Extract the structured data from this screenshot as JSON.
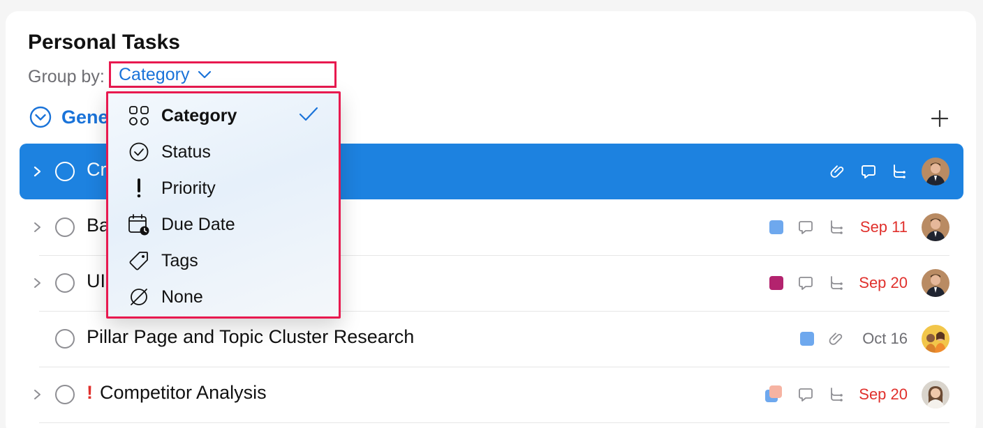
{
  "page": {
    "title": "Personal Tasks"
  },
  "group_by": {
    "label": "Group by:",
    "selected": "Category",
    "options": [
      {
        "label": "Category",
        "icon": "category-grid-icon",
        "selected": true
      },
      {
        "label": "Status",
        "icon": "status-check-circle-icon",
        "selected": false
      },
      {
        "label": "Priority",
        "icon": "priority-exclamation-icon",
        "selected": false
      },
      {
        "label": "Due Date",
        "icon": "due-date-calendar-icon",
        "selected": false
      },
      {
        "label": "Tags",
        "icon": "tag-icon",
        "selected": false
      },
      {
        "label": "None",
        "icon": "none-slash-circle-icon",
        "selected": false
      }
    ]
  },
  "group": {
    "title": "Gene",
    "icon": "collapse-chevron-circle-icon"
  },
  "tasks": [
    {
      "title": "Cr",
      "selected": true,
      "priority": false,
      "due": "",
      "icons": [
        "attachment-icon",
        "comment-icon",
        "subtask-icon"
      ],
      "avatar": "avatar-man-suit"
    },
    {
      "title": "Ba",
      "selected": false,
      "priority": false,
      "color": "#6ea8ee",
      "due": "Sep 11",
      "icons": [
        "comment-icon",
        "subtask-icon"
      ],
      "avatar": "avatar-man-suit"
    },
    {
      "title": "UI",
      "selected": false,
      "priority": false,
      "color": "#b3236e",
      "due": "Sep 20",
      "icons": [
        "comment-icon",
        "subtask-icon"
      ],
      "avatar": "avatar-man-suit"
    },
    {
      "title": "Pillar Page and Topic Cluster Research",
      "selected": false,
      "priority": false,
      "color": "#6ea8ee",
      "due": "Oct 16",
      "icons": [
        "attachment-icon"
      ],
      "avatar": "avatar-women-group"
    },
    {
      "title": "Competitor Analysis",
      "selected": false,
      "priority": true,
      "priority_mark": "!",
      "colors": [
        "#6ea8ee",
        "#f6b3a2"
      ],
      "due": "Sep 20",
      "icons": [
        "comment-icon",
        "subtask-icon"
      ],
      "avatar": "avatar-woman"
    }
  ],
  "colors": {
    "accent": "#1a73d9",
    "selection": "#1d82e0",
    "overdue": "#e0302c",
    "highlight_border": "#e8194f"
  }
}
